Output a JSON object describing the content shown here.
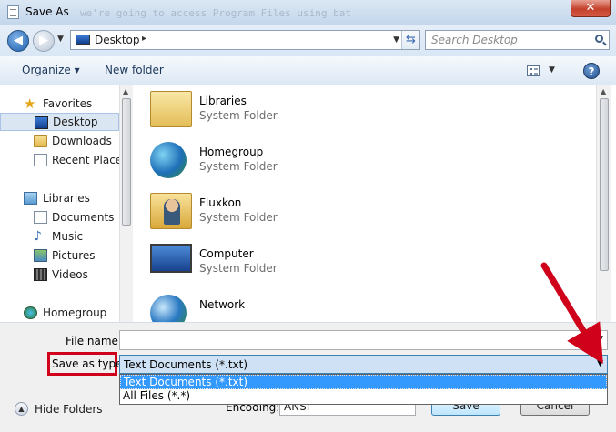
{
  "window": {
    "title": "Save As",
    "ghost_text": "we're going to access Program Files using bat",
    "close_glyph": "✕"
  },
  "address_bar": {
    "back_glyph": "◀",
    "forward_glyph": "▶",
    "crumb": "Desktop",
    "crumb_arrow": "▸",
    "refresh_glyph": "⇆",
    "search_placeholder": "Search Desktop"
  },
  "toolbar": {
    "organize_label": "Organize ▾",
    "new_folder_label": "New folder",
    "views_dropdown": "▼",
    "help_label": "?"
  },
  "nav_pane": {
    "items": [
      {
        "label": "Favorites",
        "icon": "star-icon",
        "group": true
      },
      {
        "label": "Desktop",
        "icon": "desktop-icon",
        "selected": true
      },
      {
        "label": "Downloads",
        "icon": "downloads-icon"
      },
      {
        "label": "Recent Places",
        "icon": "recent-places-icon"
      },
      {
        "label": "Libraries",
        "icon": "libraries-icon",
        "group": true
      },
      {
        "label": "Documents",
        "icon": "documents-icon"
      },
      {
        "label": "Music",
        "icon": "music-icon"
      },
      {
        "label": "Pictures",
        "icon": "pictures-icon"
      },
      {
        "label": "Videos",
        "icon": "videos-icon"
      },
      {
        "label": "Homegroup",
        "icon": "homegroup-icon",
        "group": true
      }
    ]
  },
  "content": {
    "items": [
      {
        "name": "Libraries",
        "type": "System Folder",
        "icon": "libraries-folder-icon"
      },
      {
        "name": "Homegroup",
        "type": "System Folder",
        "icon": "homegroup-icon"
      },
      {
        "name": "Fluxkon",
        "type": "System Folder",
        "icon": "user-folder-icon"
      },
      {
        "name": "Computer",
        "type": "System Folder",
        "icon": "computer-icon"
      },
      {
        "name": "Network",
        "type": "",
        "icon": "network-icon"
      }
    ]
  },
  "bottom": {
    "file_name_label": "File name:",
    "file_name_value": "",
    "save_as_type_label": "Save as type:",
    "save_as_type_value": "Text Documents (*.txt)",
    "type_options": [
      "Text Documents (*.txt)",
      "All Files  (*.*)"
    ],
    "hide_folders_label": "Hide Folders",
    "encoding_label": "Encoding:",
    "encoding_value": "ANSI",
    "save_label": "Save",
    "cancel_label": "Cancel",
    "dropdown_glyph": "▼"
  },
  "colors": {
    "annotation_red": "#d0021b",
    "selection_blue": "#3399ff"
  }
}
